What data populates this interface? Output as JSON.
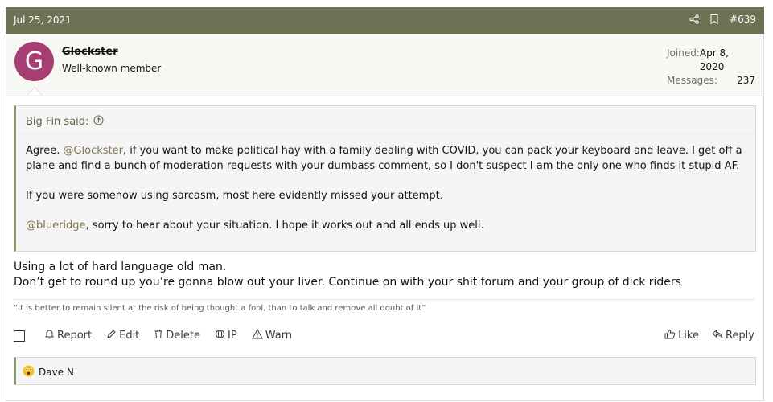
{
  "post": {
    "date": "Jul 25, 2021",
    "number": "#639"
  },
  "user": {
    "avatar_letter": "G",
    "avatar_color": "#a63e74",
    "name": "Glockster",
    "title": "Well-known member",
    "joined_label": "Joined:",
    "joined_value": "Apr 8, 2020",
    "messages_label": "Messages:",
    "messages_value": "237"
  },
  "quote": {
    "author": "Big Fin said:",
    "p1_pre": "Agree. ",
    "p1_mention": "@Glockster",
    "p1_post": ", if you want to make political hay with a family dealing with COVID, you can pack your keyboard and leave. I get off a plane and find a bunch of moderation requests with your dumbass comment, so I don't suspect I am the only one who finds it stupid AF.",
    "p2": "If you were somehow using sarcasm, most here evidently missed your attempt.",
    "p3_mention": "@blueridge",
    "p3_post": ", sorry to hear about your situation. I hope it works out and all ends up well."
  },
  "message": {
    "line1": "Using a lot of hard language old man.",
    "line2": "Don’t get to round up you’re gonna blow out your liver. Continue on with your shit forum and your group of dick riders"
  },
  "signature": "“It is better to remain silent at the risk of being thought a fool, than to talk and remove all doubt of it”",
  "actions": {
    "report": "Report",
    "edit": "Edit",
    "delete": "Delete",
    "ip": "IP",
    "warn": "Warn",
    "like": "Like",
    "reply": "Reply"
  },
  "reactions": {
    "user": "Dave N",
    "emoji": "shocked-face-icon"
  },
  "colors": {
    "header_bg": "#6b7354",
    "quote_accent": "#8e9870",
    "mention": "#7f7350"
  }
}
